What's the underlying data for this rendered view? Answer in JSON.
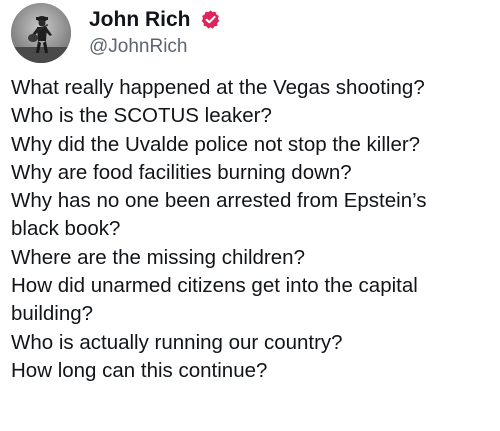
{
  "author": {
    "display_name": "John Rich",
    "handle": "@JohnRich",
    "verified_color": "#e0245e",
    "avatar_icon": "profile-photo",
    "verified_icon": "verified-badge-icon"
  },
  "tweet": {
    "lines": [
      "What really happened at the Vegas shooting?",
      "Who is the SCOTUS leaker?",
      "Why did the Uvalde police not stop the killer?",
      "Why are food facilities burning down?",
      "Why has no one been arrested from Epstein’s",
      "black book?",
      "Where are the missing children?",
      "How did unarmed citizens get into the capital",
      "building?",
      "Who is actually running our country?",
      "How long can this continue?"
    ]
  }
}
